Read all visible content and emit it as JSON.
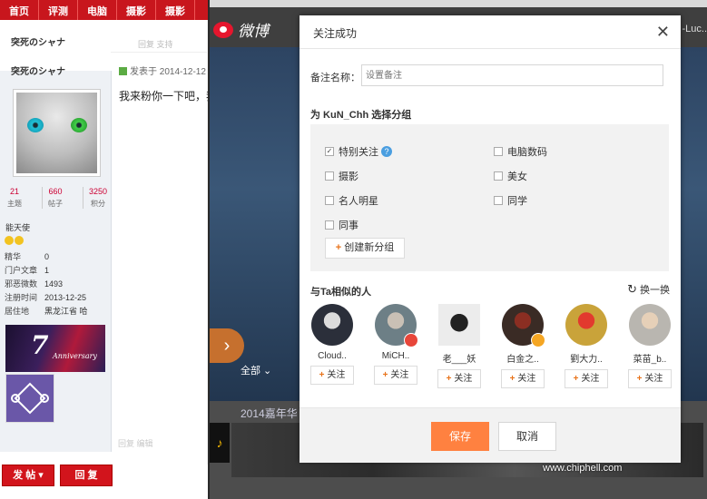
{
  "forum": {
    "nav": [
      "首页",
      "评测",
      "电脑",
      "摄影",
      "摄影"
    ],
    "post_top_actions": "回复   支持",
    "username": "突死のシャナ",
    "stats": [
      {
        "num": "21",
        "label": "主题"
      },
      {
        "num": "660",
        "label": "帖子"
      },
      {
        "num": "3250",
        "label": "积分"
      }
    ],
    "user_title": "能天使",
    "info": [
      {
        "k": "精华",
        "v": "0"
      },
      {
        "k": "门户文章",
        "v": "1"
      },
      {
        "k": "邪恶微数",
        "v": "1493"
      },
      {
        "k": "注册时间",
        "v": "2013-12-25"
      },
      {
        "k": "居住地",
        "v": "黑龙江省 哈"
      }
    ],
    "anniversary_mark": "7",
    "anniversary_text": "Anniversary",
    "post_date": "发表于 2014-12-12",
    "post_text": "我来粉你一下吧，我",
    "post_footer": "回复   编辑",
    "reply_btn_left": "发 帖",
    "reply_btn_right": "回 复"
  },
  "weibo": {
    "logo": "微博",
    "user": "-Luc..",
    "hero_arrow": "›",
    "tab_all": "全部 ⌄",
    "year_text": "2014嘉年华",
    "watermark": "www.chiphell.com",
    "chh_logo": "chip hell"
  },
  "dialog": {
    "title": "关注成功",
    "close": "✕",
    "remark_label": "备注名称：",
    "remark_placeholder": "设置备注",
    "group_title": "为 KuN_Chh 选择分组",
    "groups": [
      {
        "label": "特别关注",
        "checked": true,
        "help": true
      },
      {
        "label": "电脑数码",
        "checked": false
      },
      {
        "label": "摄影",
        "checked": false
      },
      {
        "label": "美女",
        "checked": false
      },
      {
        "label": "名人明星",
        "checked": false
      },
      {
        "label": "同学",
        "checked": false
      },
      {
        "label": "同事",
        "checked": false
      }
    ],
    "new_group": "创建新分组",
    "similar_title": "与Ta相似的人",
    "refresh": "换一换",
    "people": [
      {
        "name": "Cloud..",
        "follow": "关注",
        "color": "#2b2f3a"
      },
      {
        "name": "MiCH..",
        "follow": "关注",
        "color": "#6d7f86"
      },
      {
        "name": "老___妖",
        "follow": "关注",
        "color": "#ececec"
      },
      {
        "name": "白金之..",
        "follow": "关注",
        "color": "#3a2b25"
      },
      {
        "name": "劉大力..",
        "follow": "关注",
        "color": "#c9a33a"
      },
      {
        "name": "菜苗_b..",
        "follow": "关注",
        "color": "#b9b6b0"
      }
    ],
    "save": "保存",
    "cancel": "取消"
  }
}
